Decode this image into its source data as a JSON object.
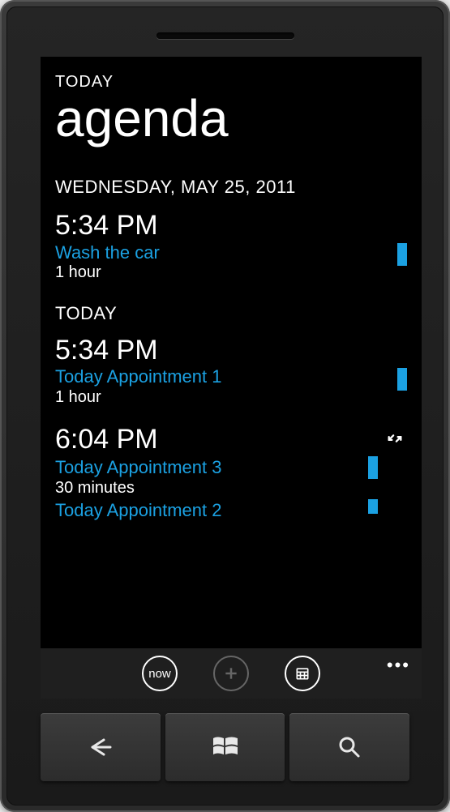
{
  "colors": {
    "accent": "#1ba1e2",
    "text": "#ffffff",
    "muted": "#666666",
    "appbar_bg": "#1f1f1f"
  },
  "header": {
    "small": "TODAY",
    "large": "agenda"
  },
  "groups": [
    {
      "heading": "WEDNESDAY, MAY 25, 2011",
      "items": [
        {
          "time": "5:34 PM",
          "entries": [
            {
              "title": "Wash the car",
              "duration": "1 hour"
            }
          ],
          "conflict": false
        }
      ]
    }
  ],
  "sections": [
    {
      "label": "TODAY",
      "items": [
        {
          "time": "5:34 PM",
          "entries": [
            {
              "title": "Today Appointment 1",
              "duration": "1 hour"
            }
          ],
          "conflict": false
        },
        {
          "time": "6:04 PM",
          "entries": [
            {
              "title": "Today Appointment 3",
              "duration": "30 minutes"
            },
            {
              "title": "Today Appointment 2",
              "duration": ""
            }
          ],
          "conflict": true
        }
      ]
    }
  ],
  "appbar": {
    "now_label": "now",
    "add_label": "+",
    "month_label": "calendar",
    "more_icon": "more-icon"
  },
  "hardware": {
    "back": "back-button",
    "start": "start-button",
    "search": "search-button"
  }
}
